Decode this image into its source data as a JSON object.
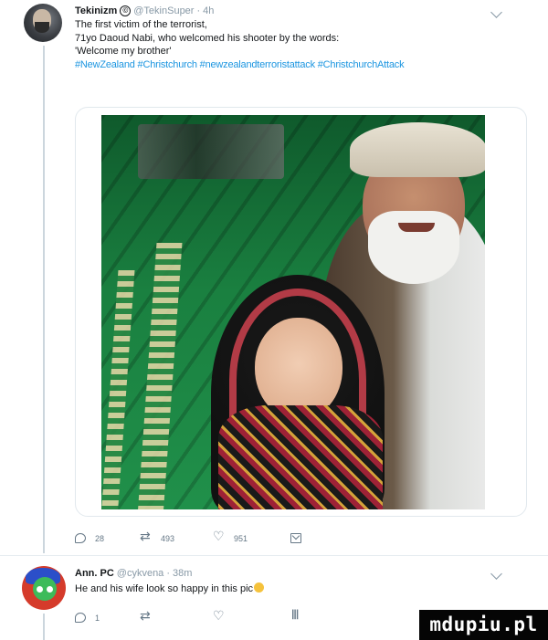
{
  "tweet": {
    "author_name": "Tekinizm",
    "verified_glyph": "©",
    "handle": "@TekinSuper",
    "separator": "·",
    "time": "4h",
    "text_lines": [
      "The first victim of the terrorist,",
      "71yo Daoud Nabi, who welcomed his shooter by the words:",
      "'Welcome my brother'"
    ],
    "hashtags": "#NewZealand #Christchurch #newzealandterroristattack #ChristchurchAttack",
    "actions": {
      "reply_count": "28",
      "retweet_count": "493",
      "like_count": "951"
    }
  },
  "reply": {
    "author_name": "Ann. PC",
    "handle": "@cykvena",
    "separator": "·",
    "time": "38m",
    "text": "He and his wife look so happy in this pic",
    "actions": {
      "reply_count": "1"
    }
  },
  "watermark": "mdupiu.pl",
  "colors": {
    "link": "#1b95e0",
    "muted": "#8899a6",
    "thread_line": "#ccd6dd"
  },
  "icons": [
    "reply-icon",
    "retweet-icon",
    "like-icon",
    "direct-message-icon",
    "analytics-icon",
    "chevron-down-icon",
    "verified-icon"
  ]
}
